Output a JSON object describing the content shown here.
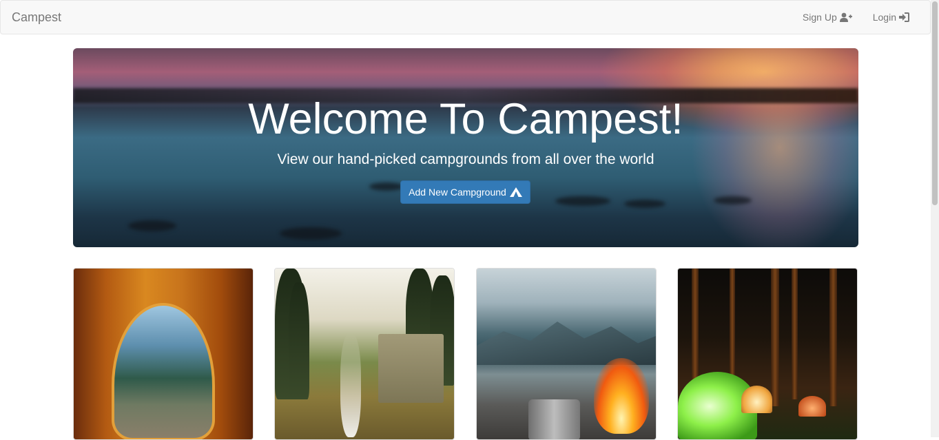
{
  "navbar": {
    "brand": "Campest",
    "signup_label": "Sign Up",
    "login_label": "Login",
    "signup_icon": "user-plus-icon",
    "login_icon": "sign-in-icon"
  },
  "hero": {
    "title": "Welcome To Campest!",
    "subtitle": "View our hand-picked campgrounds from all over the world",
    "button_label": "Add New Campground",
    "button_icon": "tent-icon",
    "button_color": "#337ab7"
  },
  "campgrounds": [
    {
      "image": "tent-interior-forest-view"
    },
    {
      "image": "campfire-smoke-forest-camp"
    },
    {
      "image": "lake-mountains-campfire-cup"
    },
    {
      "image": "night-forest-lit-tents"
    }
  ]
}
